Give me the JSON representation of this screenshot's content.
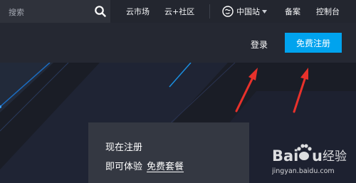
{
  "topbar": {
    "search": {
      "placeholder": "搜索",
      "value": "",
      "icon": "search-icon"
    },
    "links": [
      "云市场",
      "云+社区"
    ],
    "region": {
      "label": "中国站",
      "icon": "globe-icon"
    },
    "filing": "备案",
    "console": "控制台"
  },
  "subbar": {
    "login": "登录",
    "register": "免费注册"
  },
  "promo": {
    "line1": "现在注册",
    "line2_prefix": "即可体验",
    "line2_link": "免费套餐"
  },
  "watermark": {
    "brand": "Baidu经验",
    "url": "jingyan.baidu.com"
  },
  "colors": {
    "accent": "#00a3ee",
    "arrow": "#e8312b",
    "topbar": "#23262f",
    "hero": "#1a1d26"
  }
}
